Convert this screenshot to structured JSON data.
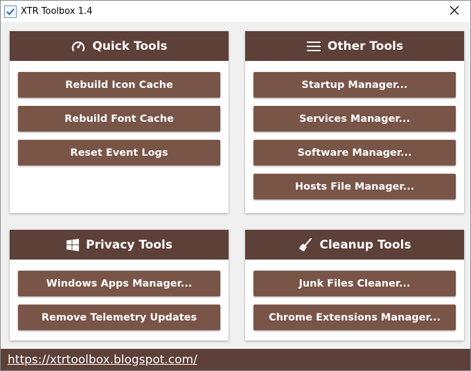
{
  "window": {
    "title": "XTR Toolbox 1.4",
    "app_icon": "checkbox-app-icon",
    "close_icon": "close-icon"
  },
  "colors": {
    "header": "#5d4037",
    "button": "#795548",
    "footer": "#5d4037",
    "panel_bg": "#ffffff",
    "window_bg": "#f0f0f0"
  },
  "panels": {
    "quick": {
      "icon": "speedometer-icon",
      "title": "Quick Tools",
      "buttons": [
        "Rebuild Icon Cache",
        "Rebuild Font Cache",
        "Reset Event Logs"
      ]
    },
    "other": {
      "icon": "menu-icon",
      "title": "Other Tools",
      "buttons": [
        "Startup Manager...",
        "Services Manager...",
        "Software Manager...",
        "Hosts File Manager..."
      ]
    },
    "privacy": {
      "icon": "windows-icon",
      "title": "Privacy Tools",
      "buttons": [
        "Windows Apps Manager...",
        "Remove Telemetry Updates"
      ]
    },
    "cleanup": {
      "icon": "broom-icon",
      "title": "Cleanup Tools",
      "buttons": [
        "Junk Files Cleaner...",
        "Chrome Extensions Manager..."
      ]
    }
  },
  "footer": {
    "link": "https://xtrtoolbox.blogspot.com/"
  }
}
